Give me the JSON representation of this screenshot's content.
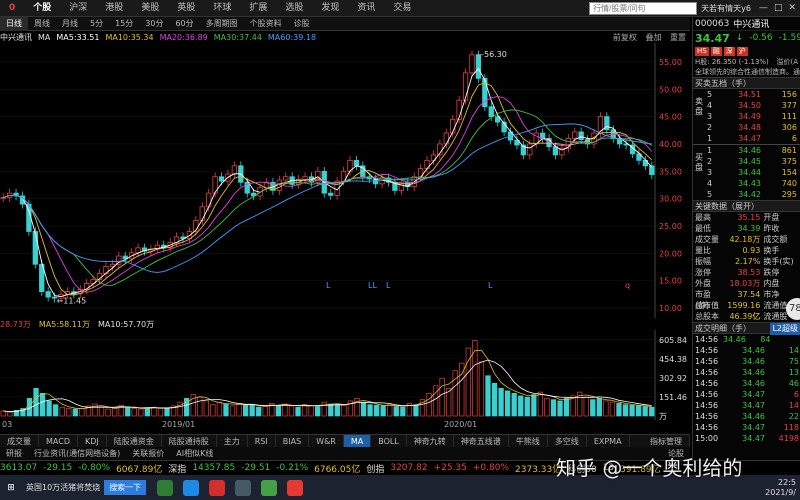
{
  "topbar": {
    "code": "0",
    "tabs": [
      "个股",
      "沪深",
      "港股",
      "美股",
      "英股",
      "环球",
      "扩展",
      "选股",
      "发现",
      "资讯",
      "交易"
    ],
    "active": "个股",
    "search_placeholder": "行情/股票/问句",
    "user": "天若有情天y6",
    "win": [
      "—",
      "□",
      "✕"
    ]
  },
  "toolbar": {
    "items": [
      "日线",
      "周线",
      "月线",
      "5分",
      "15分",
      "30分",
      "60分",
      "多周期图",
      "个股资料",
      "诊股"
    ],
    "selected": "日线"
  },
  "mabar": {
    "name": "中兴通讯",
    "ma_label": "MA",
    "ma5": "MA5:33.51",
    "ma10": "MA10:35.34",
    "ma20": "MA20:36.89",
    "ma30": "MA30:37.44",
    "ma60": "MA60:39.18",
    "right": [
      "前复权",
      "叠加",
      "重置"
    ]
  },
  "chart_data": {
    "type": "candlestick",
    "price_axis": [
      "55.00",
      "50.00",
      "45.00",
      "40.00",
      "35.00",
      "30.00",
      "25.00",
      "20.00",
      "15.00",
      "10.00"
    ],
    "ylim": [
      10,
      56.3
    ],
    "high_label": "56.30",
    "low_label": "11.45",
    "markers": [
      "L",
      "LL",
      "L",
      "L",
      "q"
    ],
    "date_labels": [
      "03",
      "2019/01",
      "2020/01"
    ],
    "close_series": [
      30.2,
      31,
      30.5,
      29,
      24,
      18,
      13,
      12,
      11.8,
      12.5,
      13,
      12.6,
      13.4,
      14.5,
      15.2,
      16.3,
      17.6,
      18,
      19.5,
      19,
      20.1,
      21,
      20.4,
      20.8,
      21.5,
      21,
      22,
      23,
      22.7,
      24,
      26,
      28.5,
      31,
      34,
      33.2,
      34.5,
      36,
      33,
      31,
      30.5,
      32,
      33,
      31.5,
      33.4,
      34,
      32.6,
      33.5,
      34,
      33,
      35,
      31,
      30.6,
      33.2,
      35,
      37,
      36,
      34,
      33.6,
      32.7,
      33.8,
      33,
      31.5,
      33,
      32.2,
      34,
      35.5,
      37,
      38,
      40,
      42,
      44.5,
      48,
      53,
      56.3,
      52,
      46.8,
      45,
      44,
      42.2,
      40.7,
      39.8,
      38,
      40,
      42,
      41,
      39.5,
      38,
      39.2,
      41,
      42.2,
      40.8,
      40,
      42,
      45,
      42.6,
      41,
      40,
      39.8,
      38.2,
      37,
      36,
      34.4
    ]
  },
  "volume": {
    "header_vol": "28.73万",
    "ma5": "MA5:58.11万",
    "ma10": "MA10:57.70万",
    "axis": [
      "605.84",
      "454.38",
      "302.92",
      "151.46",
      "万"
    ],
    "values": [
      40,
      30,
      45,
      60,
      140,
      220,
      180,
      120,
      90,
      70,
      60,
      55,
      60,
      80,
      95,
      70,
      55,
      60,
      85,
      70,
      60,
      55,
      65,
      70,
      60,
      65,
      80,
      110,
      140,
      170,
      150,
      120,
      90,
      110,
      95,
      80,
      100,
      85,
      90,
      70,
      75,
      100,
      85,
      95,
      80,
      70,
      90,
      80,
      75,
      110,
      95,
      90,
      85,
      120,
      140,
      110,
      90,
      85,
      80,
      90,
      75,
      70,
      100,
      90,
      130,
      180,
      240,
      300,
      220,
      360,
      420,
      540,
      600,
      430,
      320,
      260,
      220,
      200,
      180,
      160,
      150,
      170,
      190,
      140,
      130,
      120,
      140,
      160,
      190,
      150,
      130,
      140,
      120,
      110,
      100,
      90,
      85,
      80,
      75,
      70
    ]
  },
  "indtabs": [
    "成交量",
    "MACD",
    "KDJ",
    "陆股通资金",
    "陆股通持股",
    "主力",
    "RSI",
    "BIAS",
    "W&R",
    "MA",
    "BOLL",
    "神奇九转",
    "神奇五线谱",
    "牛熊线",
    "多空线",
    "EXPMA",
    "指标管理"
  ],
  "indtabs_sel": "MA",
  "bottombar": [
    "研报",
    "行业资讯(通信网络设备)",
    "关联报价",
    "AI相似K线"
  ],
  "right_tag": "论股",
  "ticker": [
    {
      "text": "3613.07",
      "cls": "dn"
    },
    {
      "text": "-29.15",
      "cls": "dn"
    },
    {
      "text": "-0.80%",
      "cls": "dn"
    },
    {
      "text": "6067.89亿",
      "cls": "ye"
    },
    {
      "text": "深指",
      "cls": "wh"
    },
    {
      "text": "14357.85",
      "cls": "dn"
    },
    {
      "text": "-29.51",
      "cls": "dn"
    },
    {
      "text": "-0.21%",
      "cls": "dn"
    },
    {
      "text": "6766.05亿",
      "cls": "ye"
    },
    {
      "text": "创指",
      "cls": "wh"
    },
    {
      "text": "3207.82",
      "cls": "up"
    },
    {
      "text": "+25.35",
      "cls": "up"
    },
    {
      "text": "+0.80%",
      "cls": "up"
    },
    {
      "text": "2373.33亿",
      "cls": "ye"
    },
    {
      "text": "科创50",
      "cls": "wh"
    },
    {
      "text": "13",
      "cls": "wh"
    },
    {
      "text": "391.89亿",
      "cls": "ye"
    }
  ],
  "taskbar": {
    "news": "英国10万活猪将焚烧",
    "btn": "搜索一下",
    "time": "22:5",
    "date": "2021/9/"
  },
  "watermark": "知乎 @一个奥利给的",
  "bubble": "78",
  "stock": {
    "code": "000063",
    "name": "中兴通讯",
    "price": "34.47",
    "arrow": "↓",
    "change": "-0.56",
    "pct": "-1.59%",
    "tags": [
      "HS",
      "融",
      "深",
      "沪"
    ],
    "h_line": "H股: 26.350 (-1.13%)",
    "desc": "全球领先的综合性通信制造商。通",
    "premium": "溢价(A"
  },
  "orderbook": {
    "title": "买卖五档（手）",
    "sell_side": "卖盘",
    "buy_side": "买盘",
    "sells": [
      {
        "n": "5",
        "p": "34.51",
        "v": "156"
      },
      {
        "n": "4",
        "p": "34.50",
        "v": "377"
      },
      {
        "n": "3",
        "p": "34.49",
        "v": "111"
      },
      {
        "n": "2",
        "p": "34.48",
        "v": "306"
      },
      {
        "n": "1",
        "p": "34.47",
        "v": "6"
      }
    ],
    "buys": [
      {
        "n": "1",
        "p": "34.46",
        "v": "861"
      },
      {
        "n": "2",
        "p": "34.45",
        "v": "375"
      },
      {
        "n": "3",
        "p": "34.44",
        "v": "154"
      },
      {
        "n": "4",
        "p": "34.43",
        "v": "740"
      },
      {
        "n": "5",
        "p": "34.42",
        "v": "295"
      }
    ]
  },
  "keydata": {
    "title": "关键数据（展开）",
    "rows": [
      {
        "k": "最高",
        "v": "35.15",
        "c": "up",
        "k2": "开盘"
      },
      {
        "k": "最低",
        "v": "34.39",
        "c": "dn",
        "k2": "昨收"
      },
      {
        "k": "成交量",
        "v": "42.18万",
        "c": "ye",
        "k2": "成交额"
      },
      {
        "k": "量比",
        "v": "0.93",
        "c": "ye",
        "k2": "换手"
      },
      {
        "k": "振幅",
        "v": "2.17%",
        "c": "ye",
        "k2": "换手(实)"
      },
      {
        "k": "涨停",
        "v": "38.53",
        "c": "up",
        "k2": "跌停"
      },
      {
        "k": "外盘",
        "v": "18.03万",
        "c": "up",
        "k2": "内盘"
      },
      {
        "k": "市盈(静)",
        "v": "37.54",
        "c": "ye",
        "k2": "市净"
      },
      {
        "k": "总市值",
        "v": "1599.16亿",
        "c": "ye",
        "k2": "流通值"
      },
      {
        "k": "总股本",
        "v": "46.39亿",
        "c": "ye",
        "k2": "流通股"
      }
    ]
  },
  "trades": {
    "title": "成交明细（手）",
    "l2": "L2超级",
    "rows": [
      {
        "t": "14:56",
        "p": "34.46",
        "q": "84",
        "pc": "dn",
        "qc": "dn"
      },
      {
        "t": "14:56",
        "p": "34.46",
        "q": "14",
        "pc": "dn",
        "qc": "dn"
      },
      {
        "t": "14:56",
        "p": "34.46",
        "q": "75",
        "pc": "dn",
        "qc": "dn"
      },
      {
        "t": "14:56",
        "p": "34.46",
        "q": "13",
        "pc": "dn",
        "qc": "dn"
      },
      {
        "t": "14:56",
        "p": "34.46",
        "q": "46",
        "pc": "dn",
        "qc": "dn"
      },
      {
        "t": "14:56",
        "p": "34.47",
        "q": "6",
        "pc": "dn",
        "qc": "up"
      },
      {
        "t": "14:56",
        "p": "34.47",
        "q": "14",
        "pc": "dn",
        "qc": "up"
      },
      {
        "t": "14:56",
        "p": "34.46",
        "q": "22",
        "pc": "dn",
        "qc": "dn"
      },
      {
        "t": "14:56",
        "p": "34.47",
        "q": "118",
        "pc": "dn",
        "qc": "up"
      },
      {
        "t": "15:00",
        "p": "34.47",
        "q": "4198",
        "pc": "dn",
        "qc": "up"
      }
    ]
  },
  "colors": {
    "up": "#e84040",
    "down": "#3ec43e",
    "ma5": "#ffffff",
    "ma10": "#e0c020",
    "ma20": "#e040e0",
    "ma30": "#40c040",
    "ma60": "#40a0ff"
  }
}
